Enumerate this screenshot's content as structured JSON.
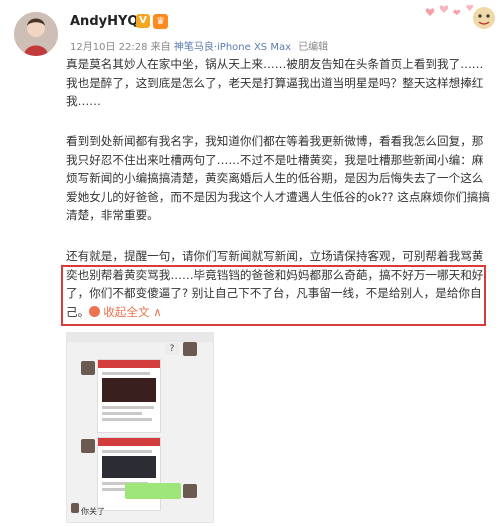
{
  "post": {
    "username": "AndyHYQ",
    "verified_badge": "V",
    "member_badge": "♛",
    "date": "12月10日 22:28",
    "from_label": "来自",
    "source": "神笔马良·iPhone XS Max",
    "edited": "已编辑"
  },
  "body": {
    "p1": "真是莫名其妙人在家中坐，锅从天上来……被朋友告知在头条首页上看到我了……我也是醉了，这到底是怎么了，老天是打算逼我出道当明星是吗？整天这样想捧红我……",
    "p2": "看到到处新闻都有我名字，我知道你们都在等着我更新微博，看看我怎么回复，那我只好忍不住出来吐槽两句了……不过不是吐槽黄奕，我是吐槽那些新闻小编：麻烦写新闻的小编搞搞清楚，黄奕离婚后人生的低谷期，是因为后悔失去了一个这么爱她女儿的好爸爸，而不是因为我这个人才遭遇人生低谷的ok?? 这点麻烦你们搞搞清楚，非常重要。",
    "p3_before": "还有就是，提醒一句，请你们写新闻就写新闻，立场请保持客观，可别帮着我骂黄奕也别帮着黄奕骂我……毕竟铛铛的爸爸和妈妈都那么奇葩，搞不好万一哪天和好了，你们不都变傻逼了? 别让自己下不了台，凡事留一线，不是给别人，是给你自己。",
    "collapse_label": "收起全文",
    "collapse_arrow": "∧"
  },
  "screenshot_thumb": {
    "bubble_q": "?",
    "reply": "你关了"
  },
  "colors": {
    "accent": "#eb7350",
    "highlight_border": "#d93a3a",
    "source_link": "#5b7bb0",
    "meta_gray": "#888888"
  }
}
